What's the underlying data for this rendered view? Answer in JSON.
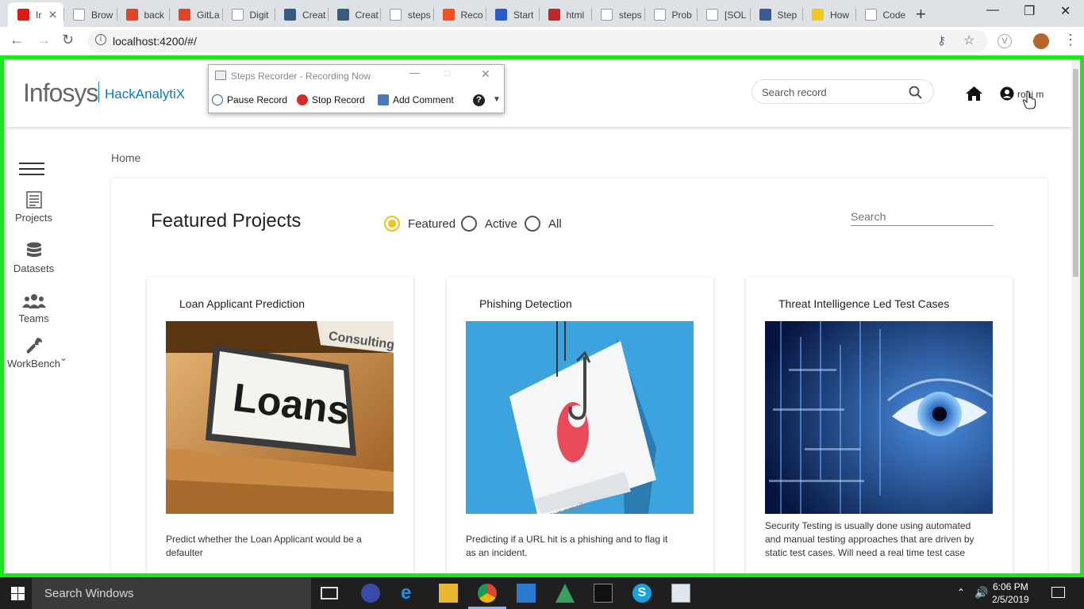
{
  "browser": {
    "tabs": [
      {
        "label": "Ir",
        "active": true,
        "icon": "angular-icon"
      },
      {
        "label": "Brow",
        "icon": "page-icon"
      },
      {
        "label": "back",
        "icon": "gitlab-icon"
      },
      {
        "label": "GitLa",
        "icon": "gitlab-icon"
      },
      {
        "label": "Digit",
        "icon": "k-icon"
      },
      {
        "label": "Creat",
        "icon": "doc-icon"
      },
      {
        "label": "Creat",
        "icon": "doc-icon"
      },
      {
        "label": "steps",
        "icon": "google-icon"
      },
      {
        "label": "Reco",
        "icon": "microsoft-icon"
      },
      {
        "label": "Start",
        "icon": "flag-icon"
      },
      {
        "label": "html",
        "icon": "n-icon"
      },
      {
        "label": "steps",
        "icon": "google-icon"
      },
      {
        "label": "Prob",
        "icon": "page-icon"
      },
      {
        "label": "[SOL",
        "icon": "sol-icon"
      },
      {
        "label": "Step",
        "icon": "monitor-icon"
      },
      {
        "label": "How",
        "icon": "l-icon"
      },
      {
        "label": "Code",
        "icon": "codepen-icon"
      }
    ],
    "url": "localhost:4200/#/"
  },
  "app": {
    "logo": "Infosys",
    "logo_sub": "HackAnalytiX",
    "search_placeholder": "Search record",
    "user_name": "rohi m"
  },
  "sidenav": {
    "items": [
      {
        "label": "Projects"
      },
      {
        "label": "Datasets"
      },
      {
        "label": "Teams"
      },
      {
        "label": "WorkBench"
      }
    ]
  },
  "breadcrumb": "Home",
  "main": {
    "title": "Featured Projects",
    "filters": [
      "Featured",
      "Active",
      "All"
    ],
    "selected_filter": "Featured",
    "search_placeholder": "Search",
    "cards": [
      {
        "title": "Loan Applicant Prediction",
        "image_text": "Loans",
        "image_text_small": "Consulting",
        "description": "Predict whether the Loan Applicant would be a defaulter"
      },
      {
        "title": "Phishing Detection",
        "image_text": "your email",
        "description": "Predicting if a URL hit is a phishing and to flag it as an incident."
      },
      {
        "title": "Threat Intelligence Led Test Cases",
        "description": "Security Testing is usually done using automated and manual testing approaches that are driven by static test cases. Will need a real time test case"
      }
    ]
  },
  "steps_recorder": {
    "title": "Steps Recorder - Recording Now",
    "pause": "Pause Record",
    "stop": "Stop Record",
    "comment": "Add Comment"
  },
  "taskbar": {
    "search": "Search Windows",
    "time": "6:06 PM",
    "date": "2/5/2019"
  },
  "colors": {
    "accent": "#0a7bc2",
    "radio_selected": "#f3c20e",
    "frame_border": "#1ee61e"
  }
}
